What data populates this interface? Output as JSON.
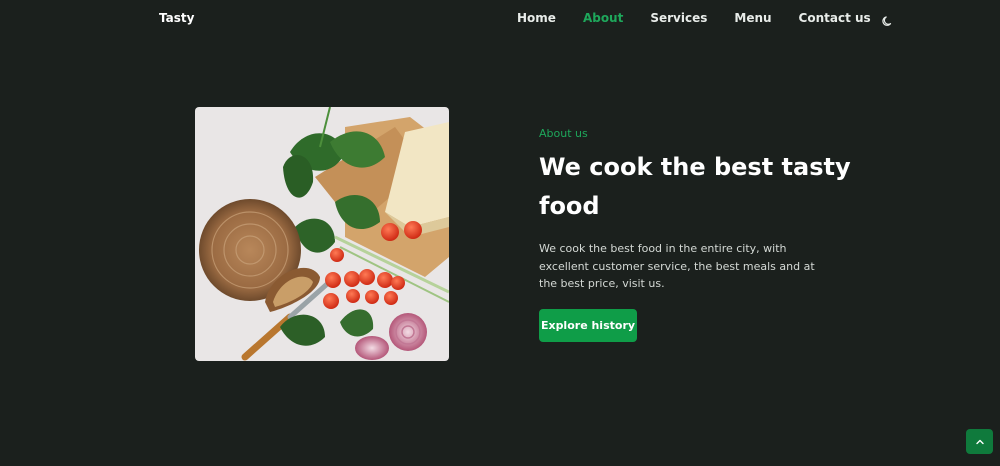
{
  "header": {
    "logo": "Tasty",
    "nav": [
      {
        "label": "Home"
      },
      {
        "label": "About"
      },
      {
        "label": "Services"
      },
      {
        "label": "Menu"
      },
      {
        "label": "Contact us"
      }
    ],
    "active_item": "About",
    "theme_icon": "moon-icon"
  },
  "about": {
    "subtitle": "About us",
    "title": "We cook the best tasty food",
    "description": "We cook the best food in the entire city, with excellent customer service, the best meals and at the best price, visit us.",
    "button_label": "Explore history"
  },
  "scrollup": {
    "icon": "chevron-up-icon"
  },
  "colors": {
    "background": "#1b201d",
    "accent": "#1ea75b",
    "button": "#0f9d48",
    "text": "#ffffff"
  }
}
